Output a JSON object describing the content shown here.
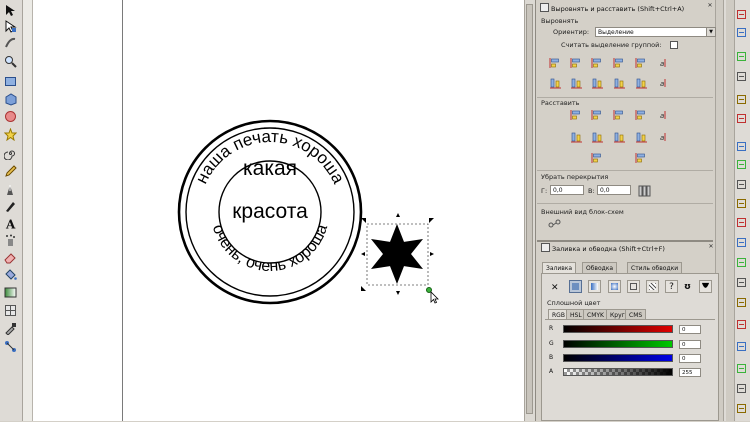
{
  "align_panel": {
    "title": "Выровнять и расставить (Shift+Ctrl+A)",
    "align_heading": "Выровнять",
    "relative_label": "Ориентир:",
    "relative_value": "Выделение",
    "group_label": "Считать выделение группой:",
    "distribute_heading": "Расставить",
    "overlaps_heading": "Убрать перекрытия",
    "h_label": "Г:",
    "h_value": "0,0",
    "v_label": "В:",
    "v_value": "0,0",
    "connectors_heading": "Внешний вид блок-схем"
  },
  "fill_panel": {
    "title": "Заливка и обводка (Shift+Ctrl+F)",
    "tabs": [
      "Заливка",
      "Обводка",
      "Стиль обводки"
    ],
    "fill_type_selected": "flat-color",
    "flat_color_heading": "Сплошной цвет",
    "modes": [
      "RGB",
      "HSL",
      "CMYK",
      "Круг",
      "CMS"
    ],
    "channels": [
      {
        "label": "R",
        "value": "0",
        "color": "#e00000"
      },
      {
        "label": "G",
        "value": "0",
        "color": "#00c800"
      },
      {
        "label": "B",
        "value": "0",
        "color": "#0000e6"
      },
      {
        "label": "A",
        "value": "255",
        "color": "#000000"
      }
    ]
  },
  "stamp": {
    "top_text": "наша печать хороша",
    "bottom_text": "очень, очень хороша",
    "line1": "какая",
    "line2": "красота"
  },
  "colors": {
    "canvas": "#ffffff",
    "panel": "#d4d0c8",
    "selected_fill": "#000000"
  }
}
